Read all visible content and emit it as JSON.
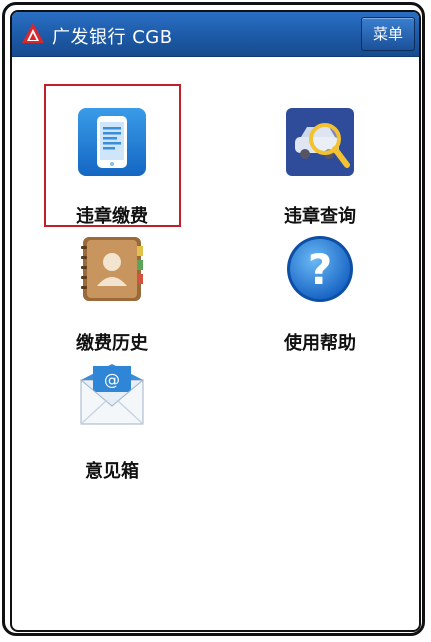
{
  "header": {
    "title": "广发银行 CGB",
    "menu_label": "菜单",
    "color": "#1d5aa7"
  },
  "tiles": [
    {
      "label": "违章缴费",
      "icon": "phone-document-icon",
      "selected": true
    },
    {
      "label": "违章查询",
      "icon": "car-magnifier-icon",
      "selected": false
    },
    {
      "label": "缴费历史",
      "icon": "contact-book-icon",
      "selected": false
    },
    {
      "label": "使用帮助",
      "icon": "question-mark-icon",
      "selected": false
    },
    {
      "label": "意见箱",
      "icon": "mail-envelope-icon",
      "selected": false
    }
  ],
  "colors": {
    "selection": "#c0202a",
    "accent": "#1d5aa7"
  }
}
